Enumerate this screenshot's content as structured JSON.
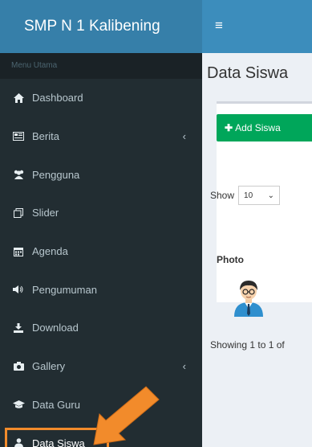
{
  "sidebar": {
    "brand": "SMP N 1 Kalibening",
    "header": "Menu Utama",
    "items": [
      {
        "label": "Dashboard",
        "icon": "home-icon"
      },
      {
        "label": "Berita",
        "icon": "newspaper-icon",
        "has_children": true
      },
      {
        "label": "Pengguna",
        "icon": "users-icon"
      },
      {
        "label": "Slider",
        "icon": "clone-icon"
      },
      {
        "label": "Agenda",
        "icon": "calendar-icon"
      },
      {
        "label": "Pengumuman",
        "icon": "volume-icon"
      },
      {
        "label": "Download",
        "icon": "download-icon"
      },
      {
        "label": "Gallery",
        "icon": "camera-icon",
        "has_children": true
      },
      {
        "label": "Data Guru",
        "icon": "graduation-cap-icon"
      },
      {
        "label": "Data Siswa",
        "icon": "user-icon",
        "active": true
      }
    ]
  },
  "topbar": {
    "menu_icon": "≡"
  },
  "main": {
    "title": "Data Siswa",
    "add_button": "Add Siswa",
    "show_label": "Show",
    "page_size": "10",
    "column_photo": "Photo",
    "info_text": "Showing 1 to 1 of"
  },
  "colors": {
    "brand_bg": "#367fa9",
    "topbar_bg": "#3c8dbc",
    "sidebar_bg": "#222d32",
    "add_button": "#00a65a",
    "highlight": "#f28b2b"
  }
}
